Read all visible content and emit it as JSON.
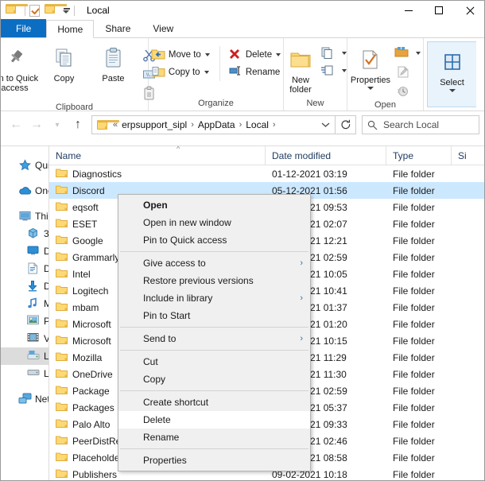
{
  "window": {
    "title": "Local",
    "qat": [
      "folder-icon",
      "properties-icon",
      "new-folder-icon"
    ],
    "controls": {
      "minimize": "Minimize",
      "maximize": "Maximize",
      "close": "Close"
    }
  },
  "tabs": [
    {
      "label": "File",
      "kind": "file"
    },
    {
      "label": "Home",
      "kind": "active"
    },
    {
      "label": "Share",
      "kind": "normal"
    },
    {
      "label": "View",
      "kind": "normal"
    }
  ],
  "ribbon": {
    "groups": [
      {
        "label": "Clipboard",
        "big": [
          {
            "label": "Pin to Quick\naccess",
            "icon": "pin-icon"
          },
          {
            "label": "Copy",
            "icon": "copy-icon"
          },
          {
            "label": "Paste",
            "icon": "paste-icon"
          }
        ],
        "small_icons": [
          {
            "name": "cut-icon"
          },
          {
            "name": "copy-path-icon"
          },
          {
            "name": "paste-shortcut-icon"
          }
        ]
      },
      {
        "label": "Organize",
        "items": [
          {
            "label": "Move to",
            "icon": "move-to-icon",
            "caret": true
          },
          {
            "label": "Copy to",
            "icon": "copy-to-icon",
            "caret": true
          },
          {
            "label": "Delete",
            "icon": "delete-icon",
            "caret": true
          },
          {
            "label": "Rename",
            "icon": "rename-icon",
            "caret": false
          }
        ]
      },
      {
        "label": "New",
        "big": [
          {
            "label": "New\nfolder",
            "icon": "new-folder-icon"
          }
        ],
        "small_icons": [
          {
            "name": "new-item-icon"
          },
          {
            "name": "easy-access-icon"
          }
        ]
      },
      {
        "label": "Open",
        "big": [
          {
            "label": "Properties",
            "icon": "properties-icon",
            "caret": true
          }
        ],
        "small_icons": [
          {
            "name": "open-with-icon"
          },
          {
            "name": "edit-icon"
          },
          {
            "name": "history-icon"
          }
        ]
      },
      {
        "label": "",
        "big": [
          {
            "label": "Select",
            "icon": "select-icon",
            "caret": true
          }
        ],
        "highlighted": true
      }
    ]
  },
  "address": {
    "back": "Back",
    "forward": "Forward",
    "recent": "Recent locations",
    "up": "Up",
    "crumbs": [
      "erpsupport_sipl",
      "AppData",
      "Local"
    ],
    "prefix": "«",
    "dropdown": "Previous locations",
    "refresh": "Refresh"
  },
  "search": {
    "placeholder": "Search Local"
  },
  "navpane": {
    "items": [
      {
        "label": "Quick access",
        "icon": "quick-access-icon",
        "indent": 0,
        "gap_before": false
      },
      {
        "label": "OneDrive",
        "icon": "onedrive-icon",
        "indent": 0,
        "gap_before": true
      },
      {
        "label": "This PC",
        "icon": "this-pc-icon",
        "indent": 0,
        "gap_before": true
      },
      {
        "label": "3D Objects",
        "icon": "3d-objects-icon",
        "indent": 1,
        "gap_before": false
      },
      {
        "label": "Desktop",
        "icon": "desktop-icon",
        "indent": 1,
        "gap_before": false
      },
      {
        "label": "Documents",
        "icon": "documents-icon",
        "indent": 1,
        "gap_before": false
      },
      {
        "label": "Downloads",
        "icon": "downloads-icon",
        "indent": 1,
        "gap_before": false
      },
      {
        "label": "Music",
        "icon": "music-icon",
        "indent": 1,
        "gap_before": false
      },
      {
        "label": "Pictures",
        "icon": "pictures-icon",
        "indent": 1,
        "gap_before": false
      },
      {
        "label": "Videos",
        "icon": "videos-icon",
        "indent": 1,
        "gap_before": false
      },
      {
        "label": "Local Disk (C:)",
        "icon": "local-disk-c-icon",
        "indent": 1,
        "gap_before": false,
        "selected": true
      },
      {
        "label": "Local Disk (D:)",
        "icon": "local-disk-d-icon",
        "indent": 1,
        "gap_before": false
      },
      {
        "label": "Network",
        "icon": "network-icon",
        "indent": 0,
        "gap_before": true
      }
    ]
  },
  "filelist": {
    "columns": [
      {
        "key": "name",
        "label": "Name",
        "sorted": "asc"
      },
      {
        "key": "date",
        "label": "Date modified"
      },
      {
        "key": "type",
        "label": "Type"
      },
      {
        "key": "size",
        "label": "Si"
      }
    ],
    "rows": [
      {
        "name": "Diagnostics",
        "date": "01-12-2021 03:19",
        "type": "File folder",
        "selected": false
      },
      {
        "name": "Discord",
        "date": "05-12-2021 01:56",
        "type": "File folder",
        "selected": true
      },
      {
        "name": "eqsoft",
        "date": "09-02-2021 09:53",
        "type": "File folder",
        "selected": false
      },
      {
        "name": "ESET",
        "date": "09-02-2021 02:07",
        "type": "File folder",
        "selected": false
      },
      {
        "name": "Google",
        "date": "09-02-2021 12:21",
        "type": "File folder",
        "selected": false
      },
      {
        "name": "Grammarly",
        "date": "09-02-2021 02:59",
        "type": "File folder",
        "selected": false
      },
      {
        "name": "Intel",
        "date": "09-02-2021 10:05",
        "type": "File folder",
        "selected": false
      },
      {
        "name": "Logitech",
        "date": "09-02-2021 10:41",
        "type": "File folder",
        "selected": false
      },
      {
        "name": "mbam",
        "date": "09-02-2021 01:37",
        "type": "File folder",
        "selected": false
      },
      {
        "name": "Microsoft",
        "date": "09-02-2021 01:20",
        "type": "File folder",
        "selected": false
      },
      {
        "name": "Microsoft",
        "date": "09-02-2021 10:15",
        "type": "File folder",
        "selected": false
      },
      {
        "name": "Mozilla",
        "date": "09-02-2021 11:29",
        "type": "File folder",
        "selected": false
      },
      {
        "name": "OneDrive",
        "date": "09-02-2021 11:30",
        "type": "File folder",
        "selected": false
      },
      {
        "name": "Package",
        "date": "09-02-2021 02:59",
        "type": "File folder",
        "selected": false
      },
      {
        "name": "Packages",
        "date": "09-02-2021 05:37",
        "type": "File folder",
        "selected": false
      },
      {
        "name": "Palo Alto",
        "date": "09-02-2021 09:33",
        "type": "File folder",
        "selected": false
      },
      {
        "name": "PeerDistRepub",
        "date": "09-02-2021 02:46",
        "type": "File folder",
        "selected": false
      },
      {
        "name": "Placeholder",
        "date": "09-02-2021 08:58",
        "type": "File folder",
        "selected": false
      },
      {
        "name": "Publishers",
        "date": "09-02-2021 10:18",
        "type": "File folder",
        "selected": false
      }
    ]
  },
  "contextmenu": {
    "items": [
      {
        "label": "Open",
        "bold": true
      },
      {
        "label": "Open in new window"
      },
      {
        "label": "Pin to Quick access"
      },
      {
        "separator": true
      },
      {
        "label": "Give access to",
        "submenu": true
      },
      {
        "label": "Restore previous versions"
      },
      {
        "label": "Include in library",
        "submenu": true
      },
      {
        "label": "Pin to Start"
      },
      {
        "separator": true
      },
      {
        "label": "Send to",
        "submenu": true
      },
      {
        "separator": true
      },
      {
        "label": "Cut"
      },
      {
        "label": "Copy"
      },
      {
        "separator": true
      },
      {
        "label": "Create shortcut"
      },
      {
        "label": "Delete",
        "highlighted": true
      },
      {
        "label": "Rename"
      },
      {
        "separator": true
      },
      {
        "label": "Properties"
      }
    ],
    "submenu_arrow": "›"
  },
  "colors": {
    "accent": "#0b6ec2",
    "selection": "#cce8ff",
    "highlight_box": "#e81123",
    "folder": "#fcd975",
    "header_text": "#1f3a5f"
  }
}
